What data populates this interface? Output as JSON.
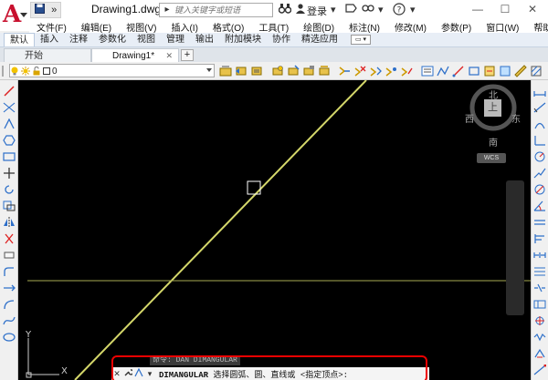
{
  "window": {
    "doc_title": "Drawing1.dwg",
    "search_placeholder": "键入关键字或短语",
    "login_label": "登录",
    "help_label": "?"
  },
  "menu": [
    "文件(F)",
    "编辑(E)",
    "视图(V)",
    "插入(I)",
    "格式(O)",
    "工具(T)",
    "绘图(D)",
    "标注(N)",
    "修改(M)",
    "参数(P)",
    "窗口(W)",
    "帮助(H)"
  ],
  "ribbon_tabs": [
    "默认",
    "插入",
    "注释",
    "参数化",
    "视图",
    "管理",
    "输出",
    "附加模块",
    "协作",
    "精选应用"
  ],
  "file_tabs": [
    {
      "label": "开始",
      "active": false
    },
    {
      "label": "Drawing1*",
      "active": true
    }
  ],
  "layer": {
    "value": "0"
  },
  "viewcube": {
    "north": "北",
    "south": "南",
    "east": "东",
    "west": "西",
    "face": "上",
    "wcs": "WCS"
  },
  "ucs": {
    "y": "Y",
    "x": "X"
  },
  "command": {
    "history": "命令: DAN DIMANGULAR",
    "name": "DIMANGULAR",
    "prompt": "选择圆弧、圆、直线或 <指定顶点>:"
  },
  "colors": {
    "canvas_bg": "#000000",
    "line": "#d4d76a",
    "highlight_frame": "#e00000",
    "app_red": "#c8102e"
  }
}
